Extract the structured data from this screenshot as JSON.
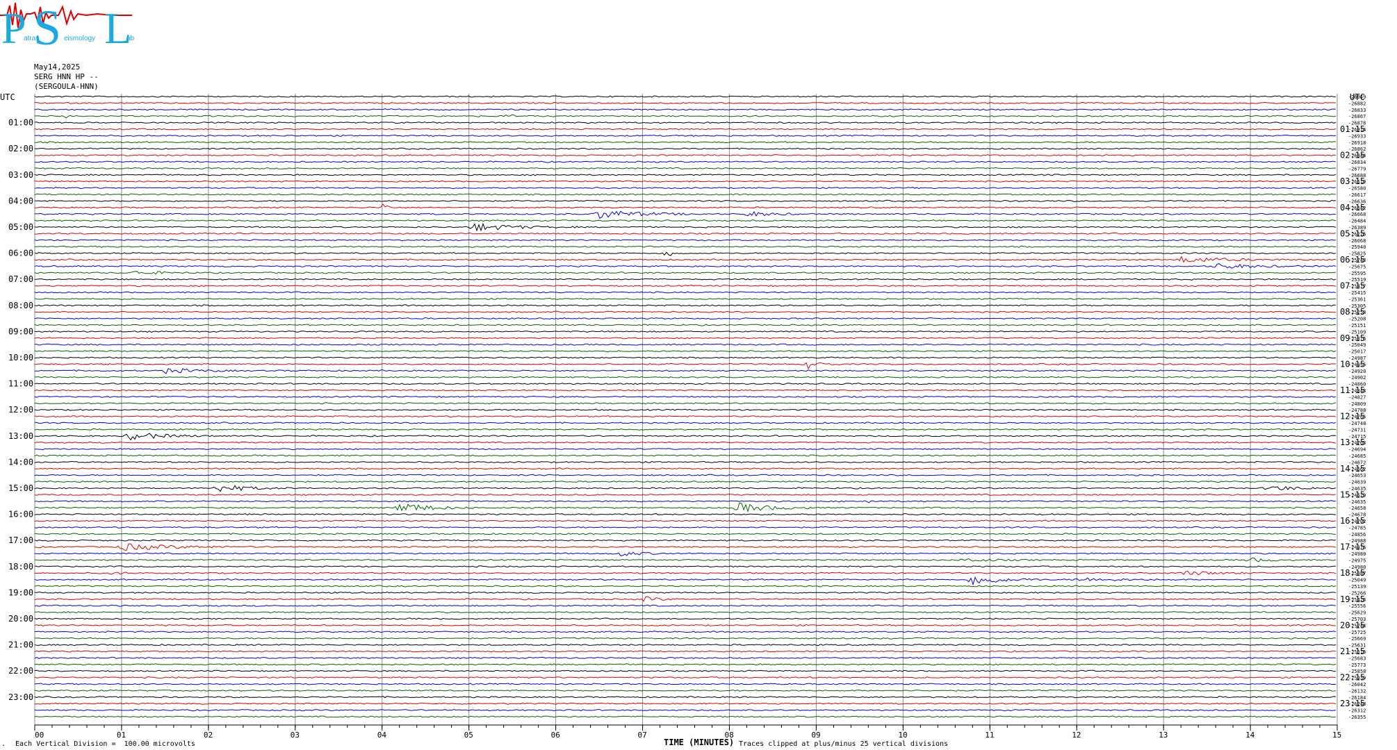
{
  "logo": {
    "big_text": "PSL",
    "small_words": [
      "atras",
      "eismology",
      "ab"
    ]
  },
  "header": {
    "date": "May14,2025",
    "station": "SERG HNN HP --",
    "station_name": "(SERGOULA-HNN)"
  },
  "left_axis_label": "UTC",
  "right_axis_label": "UTC",
  "footer": {
    "vertical_division": "Each Vertical Division =  100.00 microvolts",
    "x_title": "TIME (MINUTES)",
    "clip_note": "Traces clipped at plus/minus 25 vertical divisions"
  },
  "colors": {
    "trace_cycle": [
      "#000000",
      "#e00000",
      "#0000e0",
      "#006400"
    ],
    "grid": "#8c8c8c"
  },
  "chart_data": {
    "type": "line",
    "title": "",
    "xlabel": "TIME (MINUTES)",
    "ylabel": "UTC",
    "xlim": [
      0,
      15
    ],
    "x_ticks": [
      "00",
      "01",
      "02",
      "03",
      "04",
      "05",
      "06",
      "07",
      "08",
      "09",
      "10",
      "11",
      "12",
      "13",
      "14",
      "15"
    ],
    "rows_per_hour": 4,
    "row_count": 96,
    "left_hour_labels": [
      "01:00",
      "02:00",
      "03:00",
      "04:00",
      "05:00",
      "06:00",
      "07:00",
      "08:00",
      "09:00",
      "10:00",
      "11:00",
      "12:00",
      "13:00",
      "14:00",
      "15:00",
      "16:00",
      "17:00",
      "18:00",
      "19:00",
      "20:00",
      "21:00",
      "22:00",
      "23:00"
    ],
    "right_hour_labels": [
      "01:15",
      "02:15",
      "03:15",
      "04:15",
      "05:15",
      "06:15",
      "07:15",
      "08:15",
      "09:15",
      "10:15",
      "11:15",
      "12:15",
      "13:15",
      "14:15",
      "15:15",
      "16:15",
      "17:15",
      "18:15",
      "19:15",
      "20:15",
      "21:15",
      "22:15",
      "23:15"
    ],
    "row_offsets": [
      -26949,
      -26882,
      -26833,
      -26867,
      -26878,
      -26914,
      -26933,
      -26918,
      -26862,
      -26844,
      -26834,
      -26779,
      -26688,
      -26619,
      -26580,
      -26617,
      -26636,
      -26642,
      -26668,
      -26484,
      -26389,
      -26226,
      -26068,
      -25940,
      -25825,
      -25743,
      -25675,
      -25595,
      -25519,
      -25477,
      -25415,
      -25361,
      -25305,
      -25258,
      -25208,
      -25151,
      -25109,
      -25076,
      -25049,
      -25017,
      -24987,
      -24955,
      -24920,
      -24902,
      -24860,
      -24843,
      -24827,
      -24809,
      -24788,
      -24765,
      -24748,
      -24731,
      -24715,
      -24703,
      -24694,
      -24685,
      -24672,
      -24662,
      -24653,
      -24639,
      -24635,
      -24629,
      -24635,
      -24658,
      -24678,
      -24702,
      -24785,
      -24856,
      -24988,
      -24976,
      -24980,
      -24975,
      -24980,
      -25087,
      -25049,
      -25139,
      -25266,
      -25426,
      -25556,
      -25629,
      -25703,
      -25744,
      -25725,
      -25669,
      -25631,
      -25616,
      -25683,
      -25773,
      -25858,
      -25939,
      -26042,
      -26132,
      -26184,
      -26248,
      -26312,
      -26355
    ],
    "events": [
      {
        "row": 3,
        "minute": 0.35,
        "amp": 4,
        "len": 0.1
      },
      {
        "row": 3,
        "minute": 5.45,
        "amp": 5,
        "len": 0.12
      },
      {
        "row": 17,
        "minute": 4.05,
        "amp": 20,
        "len": 0.05
      },
      {
        "row": 18,
        "minute": 6.5,
        "amp": 7,
        "len": 1.2
      },
      {
        "row": 18,
        "minute": 8.2,
        "amp": 4,
        "len": 0.8
      },
      {
        "row": 20,
        "minute": 5.05,
        "amp": 6,
        "len": 1.2
      },
      {
        "row": 24,
        "minute": 7.28,
        "amp": 9,
        "len": 0.2
      },
      {
        "row": 25,
        "minute": 13.2,
        "amp": 4,
        "len": 1.5
      },
      {
        "row": 26,
        "minute": 13.6,
        "amp": 4,
        "len": 1.2
      },
      {
        "row": 27,
        "minute": 1.15,
        "amp": 3,
        "len": 0.8
      },
      {
        "row": 41,
        "minute": 8.9,
        "amp": 6,
        "len": 0.4
      },
      {
        "row": 42,
        "minute": 1.5,
        "amp": 4,
        "len": 1.0
      },
      {
        "row": 52,
        "minute": 1.1,
        "amp": 6,
        "len": 1.0
      },
      {
        "row": 60,
        "minute": 2.1,
        "amp": 6,
        "len": 0.9
      },
      {
        "row": 60,
        "minute": 14.2,
        "amp": 4,
        "len": 0.9
      },
      {
        "row": 62,
        "minute": 9.6,
        "amp": 5,
        "len": 0.1
      },
      {
        "row": 63,
        "minute": 4.2,
        "amp": 8,
        "len": 0.9
      },
      {
        "row": 63,
        "minute": 8.05,
        "amp": 8,
        "len": 1.0
      },
      {
        "row": 69,
        "minute": 1.0,
        "amp": 5,
        "len": 1.6
      },
      {
        "row": 70,
        "minute": 6.7,
        "amp": 4,
        "len": 0.7
      },
      {
        "row": 71,
        "minute": 10.7,
        "amp": 3,
        "len": 0.8
      },
      {
        "row": 71,
        "minute": 14.0,
        "amp": 3,
        "len": 0.6
      },
      {
        "row": 73,
        "minute": 0.9,
        "amp": 3,
        "len": 0.3
      },
      {
        "row": 73,
        "minute": 13.2,
        "amp": 3,
        "len": 1.2
      },
      {
        "row": 74,
        "minute": 10.8,
        "amp": 9,
        "len": 0.8
      },
      {
        "row": 74,
        "minute": 12.0,
        "amp": 3,
        "len": 1.2
      },
      {
        "row": 77,
        "minute": 7.0,
        "amp": 4,
        "len": 0.5
      }
    ]
  }
}
